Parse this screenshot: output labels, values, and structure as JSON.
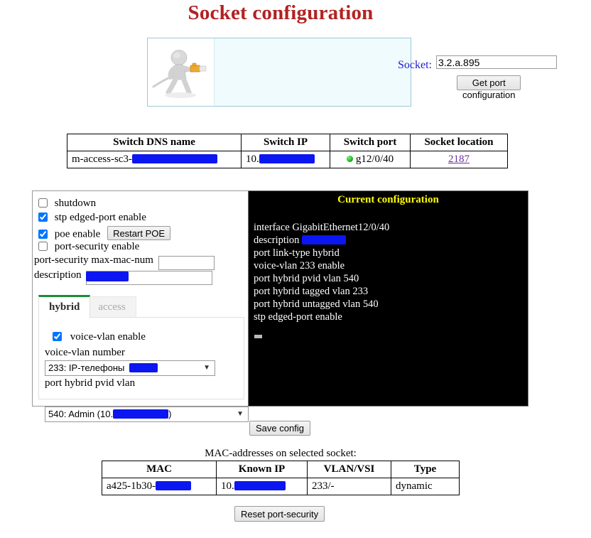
{
  "page": {
    "title": "Socket configuration"
  },
  "search": {
    "label": "Socket:",
    "value": "3.2.a.895",
    "placeholder": "",
    "submit_label": "Get port configuration",
    "figure_icon": "person-with-network-cable-icon"
  },
  "switch_table": {
    "headers": [
      "Switch DNS name",
      "Switch IP",
      "Switch port",
      "Socket location"
    ],
    "row": {
      "dns_name": "m-access-sc3-",
      "dns_name_redacted": true,
      "ip": "10.",
      "ip_redacted": true,
      "port_status": "up",
      "port": "g12/0/40",
      "socket_location": "2187"
    }
  },
  "options": {
    "shutdown": {
      "label": "shutdown",
      "checked": false
    },
    "stp_edged_port": {
      "label": "stp edged-port enable",
      "checked": true
    },
    "poe": {
      "label": "poe enable",
      "checked": true
    },
    "restart_poe_label": "Restart POE",
    "port_security": {
      "label": "port-security enable",
      "checked": false
    },
    "max_mac_num": {
      "label": "port-security max-mac-num",
      "value": ""
    },
    "description": {
      "label": "description",
      "value": "",
      "redacted": true
    }
  },
  "tabs": [
    {
      "label": "hybrid",
      "active": true
    },
    {
      "label": "access",
      "active": false
    }
  ],
  "hybrid_tab": {
    "voice_vlan_enable": {
      "label": "voice-vlan enable",
      "checked": true
    },
    "voice_vlan_number_label": "voice-vlan number",
    "voice_vlan_number_value": "233: IP-телефоны",
    "voice_vlan_number_redacted": true,
    "pvid_label": "port hybrid pvid vlan",
    "pvid_value": "540: Admin (10.",
    "pvid_value_tail": ")",
    "pvid_redacted": true
  },
  "current_config": {
    "title": "Current configuration",
    "lines": [
      "interface GigabitEthernet12/0/40",
      "description ",
      "port link-type hybrid",
      "voice-vlan 233 enable",
      "port hybrid pvid vlan 540",
      "port hybrid tagged vlan 233",
      "port hybrid untagged vlan 540",
      "stp edged-port enable"
    ],
    "description_redacted": true,
    "cursor": true
  },
  "actions": {
    "save_label": "Save config",
    "reset_label": "Reset port-security"
  },
  "mac_section": {
    "caption": "MAC-addresses on selected socket:",
    "headers": [
      "MAC",
      "Known IP",
      "VLAN/VSI",
      "Type"
    ],
    "rows": [
      {
        "mac": "a425-1b30-",
        "mac_redacted": true,
        "ip": "10.",
        "ip_redacted": true,
        "vlan": "233/-",
        "type": "dynamic"
      }
    ]
  },
  "colors": {
    "title": "#b22222",
    "config_title": "#ffff00",
    "terminal_bg": "#000000",
    "terminal_fg": "#ffffff",
    "link": "#6a2fa0",
    "label_blue": "#2020cc",
    "redaction": "#0b16f0",
    "status_up": "#12aa12",
    "tab_accent": "#1d8b37"
  }
}
